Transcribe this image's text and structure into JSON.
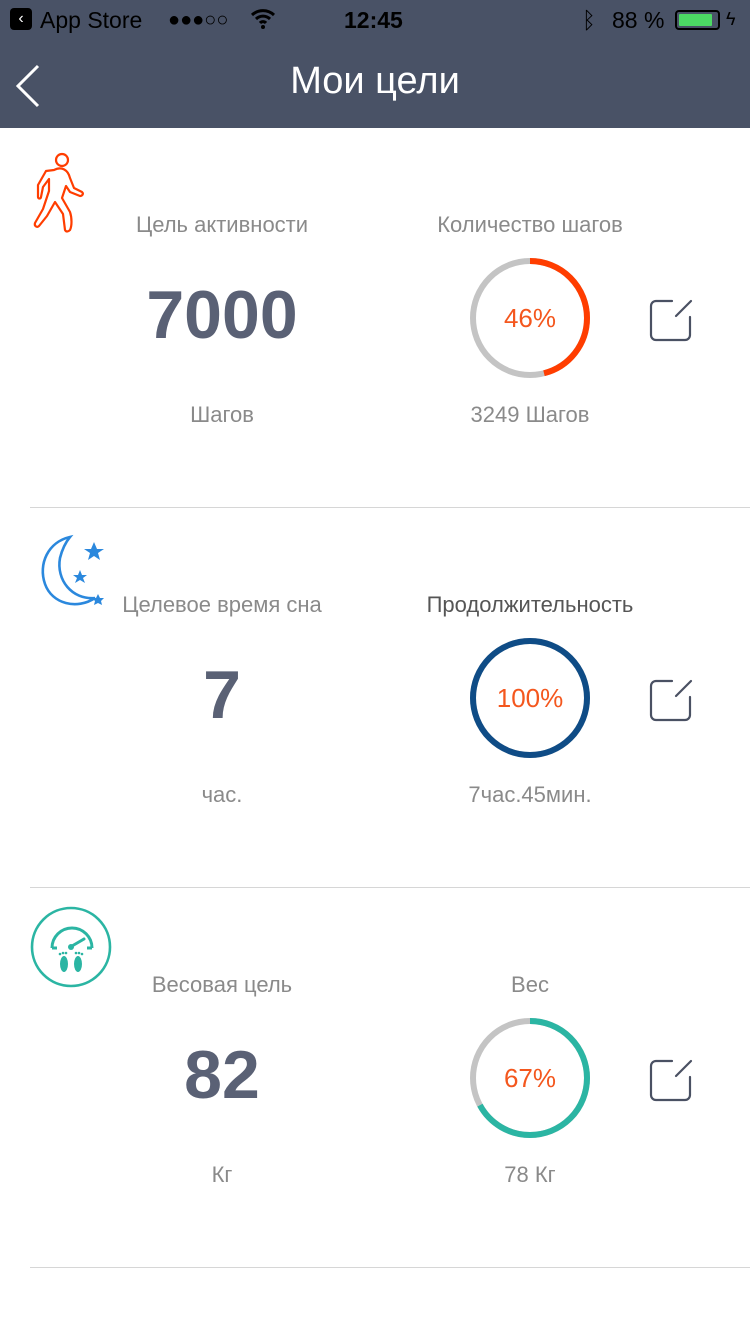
{
  "status_bar": {
    "back_app": "App Store",
    "signal": "●●●○○",
    "time": "12:45",
    "battery": "88 %"
  },
  "header": {
    "title": "Мои цели"
  },
  "goals": [
    {
      "title": "Цель активности",
      "value": "7000",
      "unit": "Шагов",
      "progress_title": "Количество шагов",
      "percent": "46%",
      "progress": 46,
      "current": "3249 Шагов",
      "color": "#ff3d00",
      "icon": "walking-person-icon"
    },
    {
      "title": "Целевое время сна",
      "value": "7",
      "unit": "час.",
      "progress_title": "Продолжительность",
      "percent": "100%",
      "progress": 100,
      "current": "7час.45мин.",
      "color": "#0f4c86",
      "icon": "moon-stars-icon"
    },
    {
      "title": "Весовая цель",
      "value": "82",
      "unit": "Кг",
      "progress_title": "Вес",
      "percent": "67%",
      "progress": 67,
      "current": "78 Кг",
      "color": "#2bb5a3",
      "icon": "scale-icon"
    }
  ]
}
